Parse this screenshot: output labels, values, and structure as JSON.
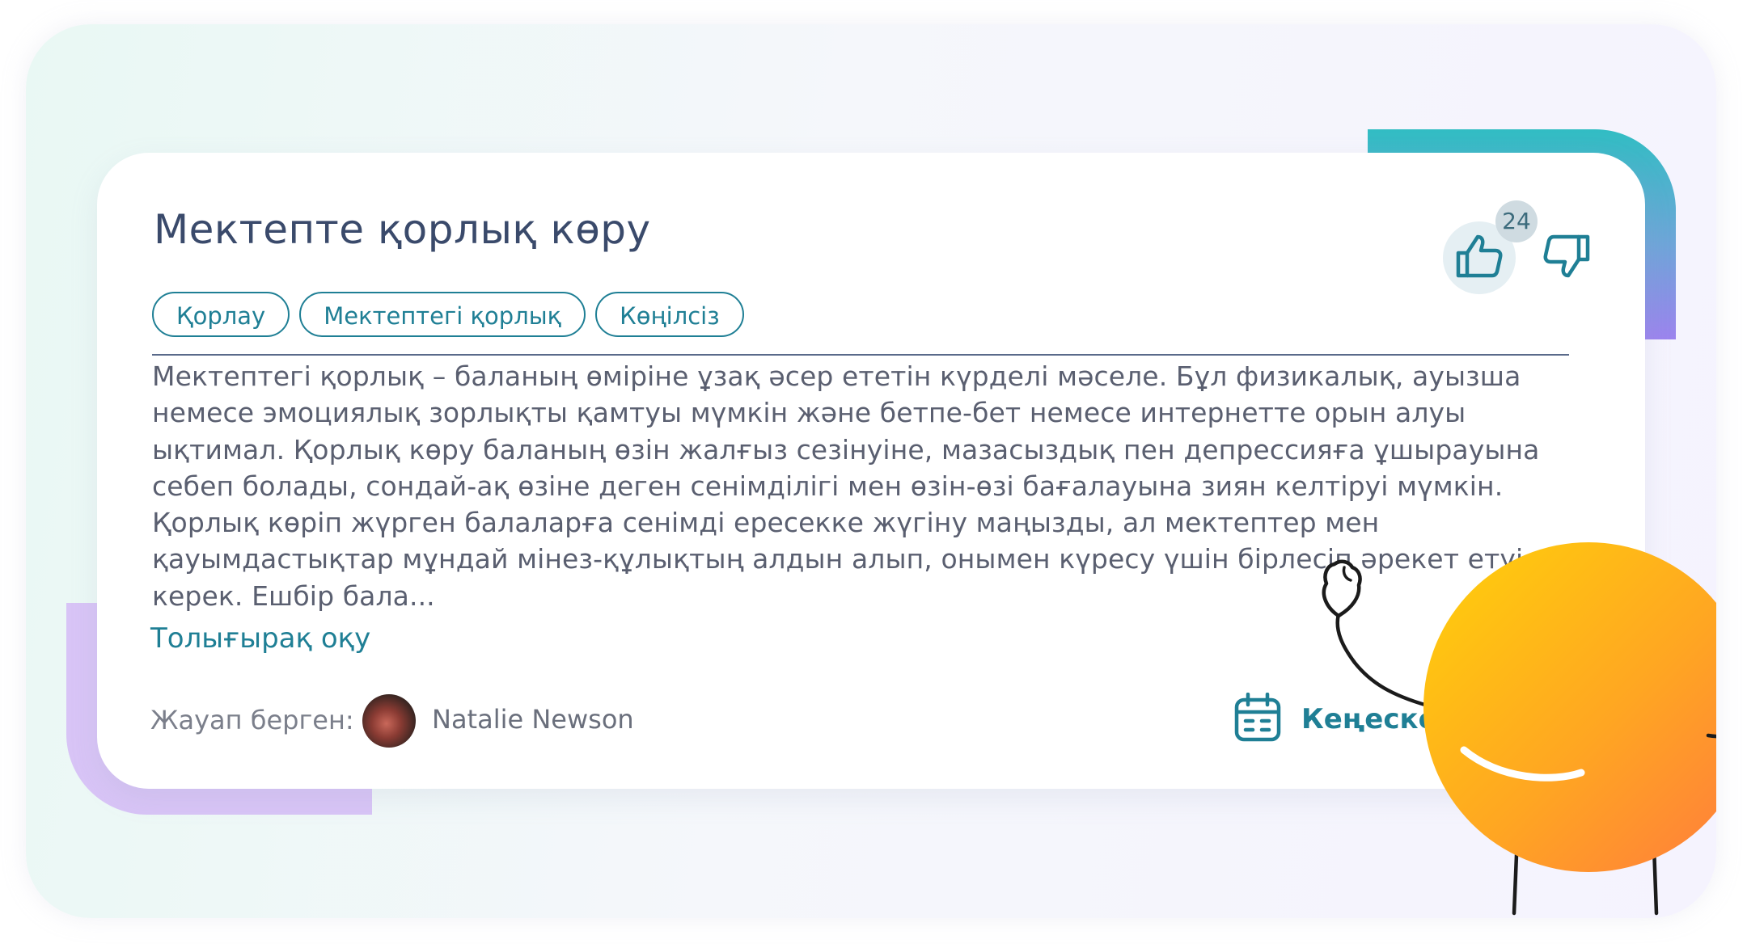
{
  "card": {
    "title": "Мектепте қорлық көру",
    "tags": [
      "Қорлау",
      "Мектептегі қорлық",
      "Көңілсіз"
    ],
    "body": "Мектептегі қорлық – баланың өміріне ұзақ әсер ететін күрделі мәселе. Бұл физикалық, ауызша немесе эмоциялық зорлықты қамтуы мүмкін және бетпе-бет немесе интернетте орын алуы ықтимал. Қорлық көру баланың өзін жалғыз сезінуіне, мазасыздық пен депрессияға ұшырауына себеп болады, сондай-ақ өзіне деген сенімділігі мен өзін-өзі бағалауына зиян келтіруі мүмкін. Қорлық көріп жүрген балаларға сенімді ересекке жүгіну маңызды, ал мектептер мен қауымдастықтар мұндай мінез-құлықтың алдын алып, онымен күресу үшін бірлесіп әрекет етуі керек. Ешбір бала...",
    "read_more": "Толығырақ оқу",
    "answered_by_label": "Жауап берген:",
    "author_name": "Natalie Newson",
    "consult_label": "Кеңеске",
    "like_count": "24"
  },
  "icons": {
    "like": "thumbs-up-icon",
    "dislike": "thumbs-down-icon",
    "calendar": "calendar-icon"
  },
  "colors": {
    "accent": "#1f7f95",
    "title": "#3a4a6b",
    "body_text": "#5a5f70",
    "deco_teal": "#31bdc3",
    "deco_purple": "#d8c4f6",
    "mascot_yellow": "#ffcb0a",
    "mascot_orange": "#ff8a3a"
  }
}
